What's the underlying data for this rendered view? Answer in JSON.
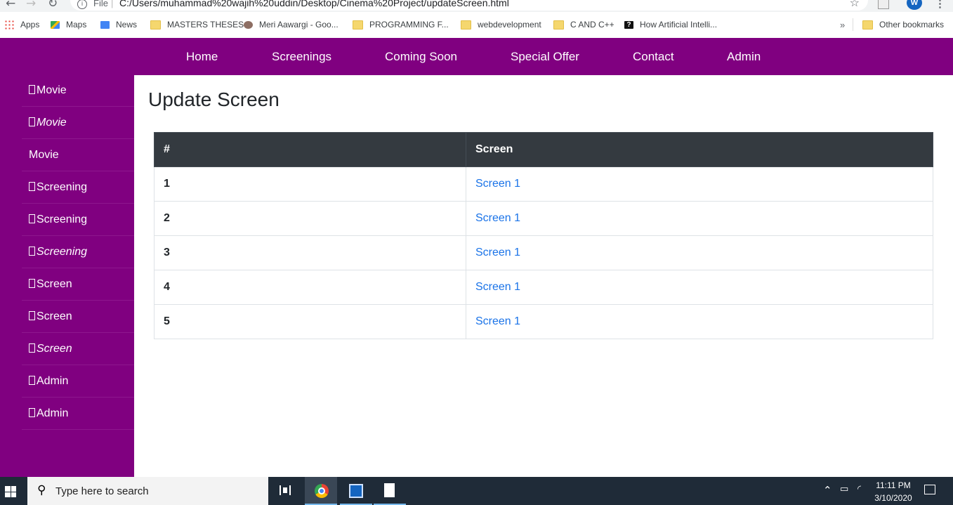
{
  "browser": {
    "scheme": "File",
    "url": "C:/Users/muhammad%20wajih%20uddin/Desktop/Cinema%20Project/updateScreen.html",
    "profile_initial": "W",
    "bookmarks": [
      {
        "label": "Apps",
        "icon": "apps-grid-icon"
      },
      {
        "label": "Maps",
        "icon": "maps-icon"
      },
      {
        "label": "News",
        "icon": "news-icon"
      },
      {
        "label": "MASTERS THESES",
        "icon": "folder-icon"
      },
      {
        "label": "Meri Aawargi - Goo...",
        "icon": "site-icon"
      },
      {
        "label": "PROGRAMMING F...",
        "icon": "folder-icon"
      },
      {
        "label": "webdevelopment",
        "icon": "folder-icon"
      },
      {
        "label": "C AND C++",
        "icon": "folder-icon"
      },
      {
        "label": "How Artificial Intelli...",
        "icon": "site-icon"
      }
    ],
    "bookmarks_overflow": "»",
    "other_bookmarks": "Other bookmarks"
  },
  "nav": {
    "items": [
      "Home",
      "Screenings",
      "Coming Soon",
      "Special Offer",
      "Contact",
      "Admin"
    ]
  },
  "sidebar": {
    "items": [
      {
        "label": "Movie",
        "glyph": true,
        "italic": false
      },
      {
        "label": "Movie",
        "glyph": true,
        "italic": true
      },
      {
        "label": "Movie",
        "glyph": false,
        "italic": false
      },
      {
        "label": "Screening",
        "glyph": true,
        "italic": false
      },
      {
        "label": "Screening",
        "glyph": true,
        "italic": false
      },
      {
        "label": "Screening",
        "glyph": true,
        "italic": true
      },
      {
        "label": "Screen",
        "glyph": true,
        "italic": false
      },
      {
        "label": "Screen",
        "glyph": true,
        "italic": false
      },
      {
        "label": "Screen",
        "glyph": true,
        "italic": true
      },
      {
        "label": "Admin",
        "glyph": true,
        "italic": false
      },
      {
        "label": "Admin",
        "glyph": true,
        "italic": false
      }
    ]
  },
  "main": {
    "title": "Update Screen",
    "table": {
      "headers": [
        "#",
        "Screen"
      ],
      "rows": [
        {
          "num": "1",
          "screen": "Screen 1"
        },
        {
          "num": "2",
          "screen": "Screen 1"
        },
        {
          "num": "3",
          "screen": "Screen 1"
        },
        {
          "num": "4",
          "screen": "Screen 1"
        },
        {
          "num": "5",
          "screen": "Screen 1"
        }
      ]
    }
  },
  "taskbar": {
    "search_placeholder": "Type here to search",
    "time": "11:11 PM",
    "date": "3/10/2020"
  },
  "colors": {
    "brand_purple": "#800080",
    "table_header": "#343a40",
    "link": "#1a73e8"
  }
}
